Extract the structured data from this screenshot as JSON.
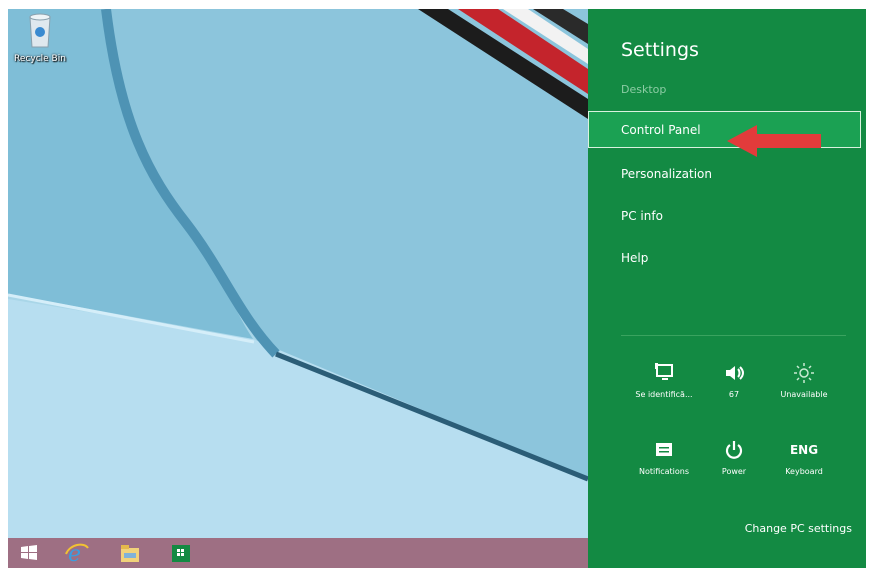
{
  "desktop": {
    "recycle_bin_label": "Recycle Bin"
  },
  "taskbar": {
    "icons": [
      "start-icon",
      "internet-explorer-icon",
      "file-explorer-icon",
      "store-icon"
    ]
  },
  "charms": {
    "title": "Settings",
    "subtitle": "Desktop",
    "items": [
      {
        "label": "Control Panel",
        "selected": true
      },
      {
        "label": "Personalization"
      },
      {
        "label": "PC info"
      },
      {
        "label": "Help"
      }
    ],
    "quick_settings": [
      {
        "icon": "network-icon",
        "label": "Se identifică..."
      },
      {
        "icon": "volume-icon",
        "label": "67"
      },
      {
        "icon": "brightness-icon",
        "label": "Unavailable"
      },
      {
        "icon": "notifications-icon",
        "label": "Notifications"
      },
      {
        "icon": "power-icon",
        "label": "Power"
      },
      {
        "icon": "keyboard-icon",
        "text": "ENG",
        "label": "Keyboard"
      }
    ],
    "footer_link": "Change PC settings",
    "colors": {
      "background": "#138a43",
      "selected": "#1ba153",
      "arrow": "#e23b3b"
    }
  }
}
